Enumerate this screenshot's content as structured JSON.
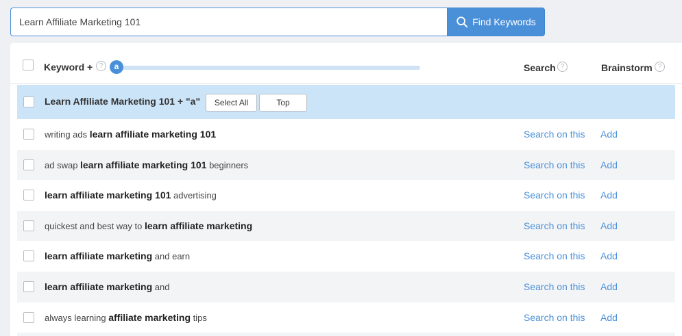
{
  "search": {
    "value": "Learn Affiliate Marketing 101",
    "button_label": "Find Keywords"
  },
  "header": {
    "keyword_label": "Keyword +",
    "slider_letter": "a",
    "search_label": "Search",
    "brainstorm_label": "Brainstorm",
    "help_glyph": "?"
  },
  "group": {
    "title": "Learn Affiliate Marketing 101 + \"a\"",
    "select_all_label": "Select All",
    "top_label": "Top"
  },
  "rows": [
    {
      "pre": "writing ads ",
      "bold": "learn affiliate marketing 101",
      "post": "",
      "search": "Search on this",
      "add": "Add"
    },
    {
      "pre": "ad swap ",
      "bold": "learn affiliate marketing 101",
      "post": " beginners",
      "search": "Search on this",
      "add": "Add"
    },
    {
      "pre": "",
      "bold": "learn affiliate marketing 101",
      "post": " advertising",
      "search": "Search on this",
      "add": "Add"
    },
    {
      "pre": "quickest and best way to ",
      "bold": "learn affiliate marketing",
      "post": "",
      "search": "Search on this",
      "add": "Add"
    },
    {
      "pre": "",
      "bold": "learn affiliate marketing",
      "post": " and earn",
      "search": "Search on this",
      "add": "Add"
    },
    {
      "pre": "",
      "bold": "learn affiliate marketing",
      "post": " and",
      "search": "Search on this",
      "add": "Add"
    },
    {
      "pre": "always learning ",
      "bold": "affiliate marketing",
      "post": " tips",
      "search": "Search on this",
      "add": "Add"
    }
  ],
  "colors": {
    "accent": "#4a90d9",
    "group_bg": "#cce4f8",
    "alt_row_bg": "#f3f4f6"
  }
}
